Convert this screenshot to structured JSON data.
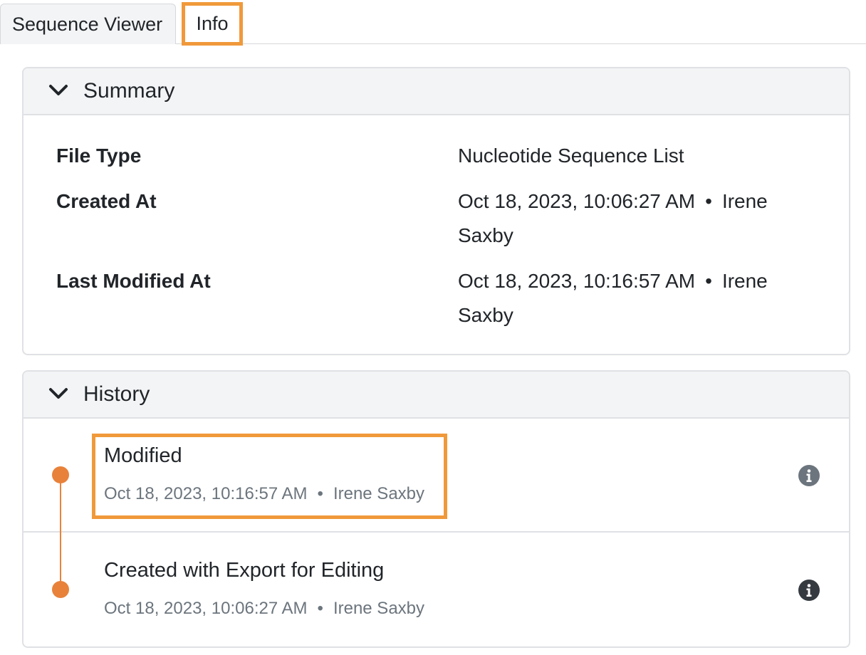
{
  "tabs": [
    {
      "label": "Sequence Viewer"
    },
    {
      "label": "Info"
    }
  ],
  "summary": {
    "title": "Summary",
    "rows": [
      {
        "label": "File Type",
        "value": "Nucleotide Sequence List"
      },
      {
        "label": "Created At",
        "value_date": "Oct 18, 2023, 10:06:27 AM",
        "value_user": "Irene",
        "value_user_cont": "Saxby"
      },
      {
        "label": "Last Modified At",
        "value_date": "Oct 18, 2023, 10:16:57 AM",
        "value_user": "Irene",
        "value_user_cont": "Saxby"
      }
    ]
  },
  "history": {
    "title": "History",
    "entries": [
      {
        "title": "Modified",
        "date": "Oct 18, 2023, 10:16:57 AM",
        "user": "Irene Saxby"
      },
      {
        "title": "Created with Export for Editing",
        "date": "Oct 18, 2023, 10:06:27 AM",
        "user": "Irene Saxby"
      }
    ]
  },
  "separator": "•",
  "icons": {
    "collapse": "chevron-down-icon",
    "info": "info-circle-icon"
  },
  "colors": {
    "highlight": "#f0993a",
    "timeline": "#e8823a"
  }
}
